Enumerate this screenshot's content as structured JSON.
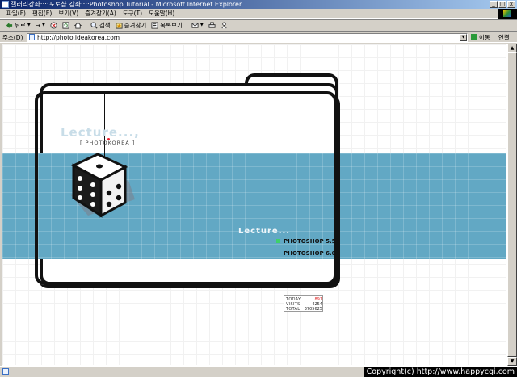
{
  "window": {
    "title": "갤러리강좌::::포토샵 강좌::::Photoshop Tutorial - Microsoft Internet Explorer",
    "controls": [
      "_",
      "□",
      "x"
    ]
  },
  "menubar": {
    "items": [
      "파일(F)",
      "편집(E)",
      "보기(V)",
      "즐겨찾기(A)",
      "도구(T)",
      "도움말(H)"
    ]
  },
  "toolbar": {
    "back": "뒤로",
    "forward": "→",
    "search": "검색",
    "favorites": "즐겨찾기",
    "history": "목록보기"
  },
  "addressbar": {
    "label": "주소(D)",
    "url": "http://photo.ideakorea.com",
    "go": "이동",
    "links": "연결"
  },
  "page": {
    "lecture_top": "Lecture...,",
    "photokorea": "[ PHOTOKOREA ]",
    "lecture_menu_title": "Lecture...",
    "menu_items": [
      "PHOTOSHOP 5.5",
      "PHOTOSHOP 6.0"
    ],
    "counter": {
      "today_label": "TODAY",
      "today_value": "891",
      "visits_label": "VISITS",
      "visits_value": "4254",
      "total_label": "TOTAL",
      "total_value": "3705625"
    },
    "colors": {
      "band": "#62a8c4",
      "folder_stroke": "#111111",
      "accent_green": "#3fd06a",
      "accent_red": "#dd2222"
    }
  },
  "statusbar": {
    "copyright": "Copyright(c) http://www.happycgi.com"
  }
}
